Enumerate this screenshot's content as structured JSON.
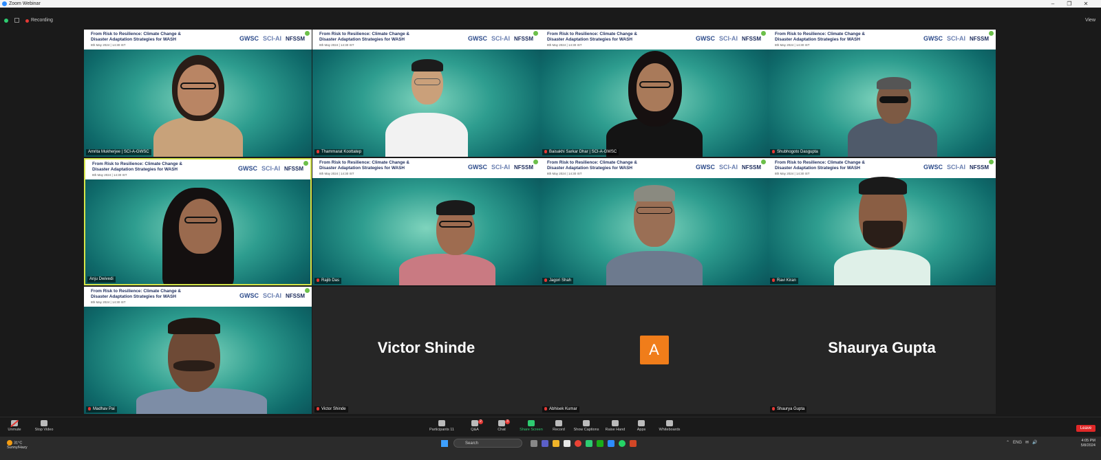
{
  "window": {
    "title": "Zoom Webinar",
    "controls": [
      "–",
      "❐",
      "✕"
    ]
  },
  "topbar": {
    "recording_label": "Recording",
    "view_label": "View"
  },
  "banner": {
    "line1": "From Risk to Resilience: Climate Change &",
    "line2": "Disaster Adaptation Strategies for WASH",
    "date": "8th May 2024 | 14:30 IST",
    "logo_gwsc": "GWSC",
    "logo_sciai": "SCI-AI",
    "logo_nfssm": "NFSSM"
  },
  "tiles": [
    {
      "name": "Amrita Mukherjee | SCI-A-GWSC",
      "muted": false
    },
    {
      "name": "Thammarat Koottatep",
      "muted": true
    },
    {
      "name": "Baisakhi Sarkar Dhar | SCI-A-GWSC",
      "muted": true
    },
    {
      "name": "Shubhogoto Dasgupta",
      "muted": true
    },
    {
      "name": "Anju Dwivedi",
      "muted": false
    },
    {
      "name": "Rajib Das",
      "muted": true
    },
    {
      "name": "Jagori Shah",
      "muted": true
    },
    {
      "name": "Ravi Kiran",
      "muted": true
    },
    {
      "name": "Madhav Pai",
      "muted": true
    },
    {
      "name": "Victor Shinde",
      "big_name": "Victor Shinde",
      "muted": true
    },
    {
      "name": "Abhisek Kumar",
      "avatar_letter": "A",
      "muted": true
    },
    {
      "name": "Shaurya Gupta",
      "big_name": "Shaurya Gupta",
      "muted": true
    }
  ],
  "toolbar": {
    "unmute": "Unmute",
    "stop_video": "Stop Video",
    "participants": "Participants",
    "participants_count": "11",
    "qa": "Q&A",
    "qa_badge": "2",
    "chat": "Chat",
    "chat_badge": "3",
    "share_screen": "Share Screen",
    "record": "Record",
    "show_captions": "Show Captions",
    "raise_hand": "Raise Hand",
    "apps": "Apps",
    "whiteboards": "Whiteboards",
    "leave": "Leave"
  },
  "taskbar": {
    "weather_temp": "31°C",
    "weather_desc": "Sunny/Hazy",
    "search_placeholder": "Search",
    "language": "ENG",
    "time": "4:05 PM",
    "date": "5/8/2024"
  },
  "colors": {
    "accent_green": "#2ecc71",
    "leave_red": "#e02828",
    "active_border": "#d6e64a"
  }
}
